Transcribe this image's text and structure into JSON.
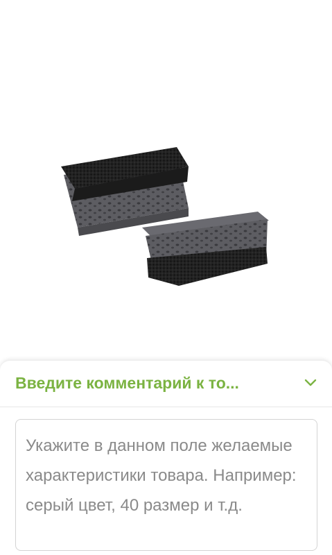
{
  "product_image": {
    "icon": "sponge-product-image",
    "description_colors": {
      "sponge": "#5a5a5f",
      "scrub": "#1e1e1e"
    }
  },
  "comment_sheet": {
    "title": "Введите комментарий к то...",
    "toggle_icon": "chevron-down-icon",
    "accent_color": "#7bb342",
    "input": {
      "value": "",
      "placeholder": "Укажите в данном поле желаемые характеристики товара. Например: серый цвет, 40 размер и т.д."
    }
  }
}
